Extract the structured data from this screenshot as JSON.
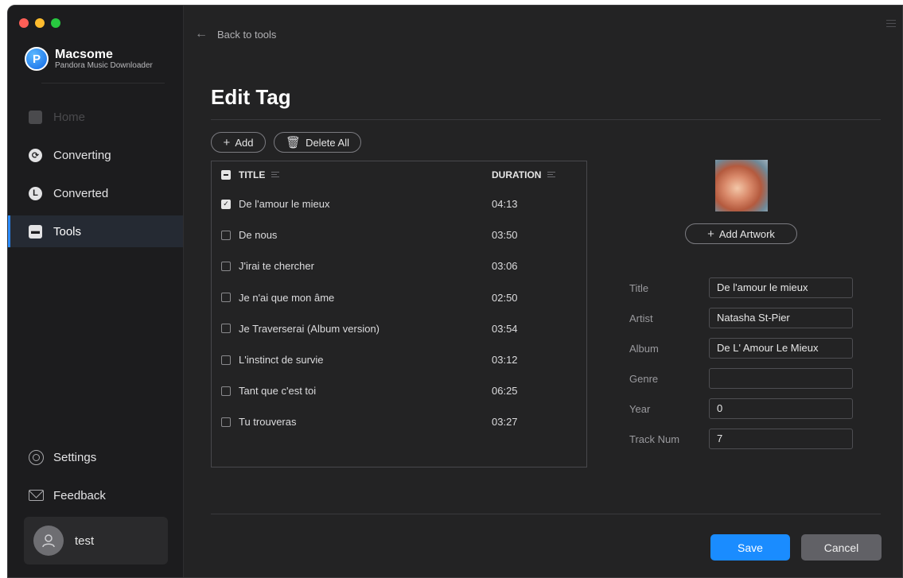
{
  "app": {
    "name": "Macsome",
    "subtitle": "Pandora Music Downloader"
  },
  "sidebar": {
    "items": [
      {
        "label": "Home",
        "state": "disabled",
        "icon": "home-icon"
      },
      {
        "label": "Converting",
        "state": "normal",
        "icon": "converting-icon"
      },
      {
        "label": "Converted",
        "state": "normal",
        "icon": "clock-icon"
      },
      {
        "label": "Tools",
        "state": "active",
        "icon": "toolbox-icon"
      }
    ],
    "bottom": [
      {
        "label": "Settings",
        "icon": "settings-icon"
      },
      {
        "label": "Feedback",
        "icon": "mail-icon"
      }
    ],
    "user": {
      "name": "test"
    }
  },
  "header": {
    "back_label": "Back to tools"
  },
  "page": {
    "title": "Edit Tag",
    "add_label": "Add",
    "delete_all_label": "Delete All"
  },
  "table": {
    "headers": {
      "title": "TITLE",
      "duration": "DURATION"
    },
    "rows": [
      {
        "title": "De l'amour le mieux",
        "duration": "04:13",
        "checked": true
      },
      {
        "title": "De nous",
        "duration": "03:50",
        "checked": false
      },
      {
        "title": "J'irai te chercher",
        "duration": "03:06",
        "checked": false
      },
      {
        "title": "Je n'ai que mon âme",
        "duration": "02:50",
        "checked": false
      },
      {
        "title": "Je Traverserai (Album version)",
        "duration": "03:54",
        "checked": false
      },
      {
        "title": "L'instinct de survie",
        "duration": "03:12",
        "checked": false
      },
      {
        "title": "Tant que c'est toi",
        "duration": "06:25",
        "checked": false
      },
      {
        "title": "Tu trouveras",
        "duration": "03:27",
        "checked": false
      }
    ]
  },
  "tag_editor": {
    "add_artwork_label": "Add Artwork",
    "fields": {
      "title": {
        "label": "Title",
        "value": "De l'amour le mieux"
      },
      "artist": {
        "label": "Artist",
        "value": "Natasha St-Pier"
      },
      "album": {
        "label": "Album",
        "value": "De L' Amour Le Mieux"
      },
      "genre": {
        "label": "Genre",
        "value": ""
      },
      "year": {
        "label": "Year",
        "value": "0"
      },
      "track": {
        "label": "Track Num",
        "value": "7"
      }
    }
  },
  "footer": {
    "save_label": "Save",
    "cancel_label": "Cancel"
  },
  "colors": {
    "accent": "#1a8cff",
    "background": "#232324",
    "sidebar": "#1c1c1e"
  }
}
